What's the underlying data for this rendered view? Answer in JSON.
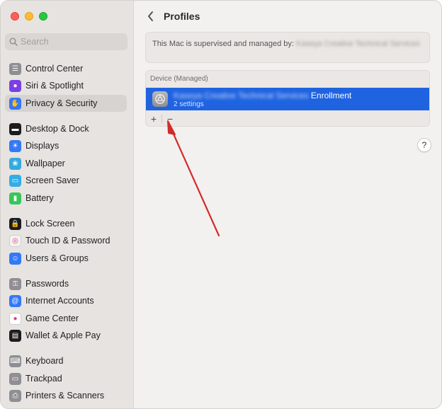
{
  "sidebar": {
    "search_placeholder": "Search",
    "items": [
      {
        "label": "Control Center",
        "icon": "control-center-icon",
        "color": "#8e8e93",
        "selected": false
      },
      {
        "label": "Siri & Spotlight",
        "icon": "siri-icon",
        "color": "#7b3fe4",
        "selected": false
      },
      {
        "label": "Privacy & Security",
        "icon": "hand-icon",
        "color": "#3478f6",
        "selected": true
      },
      {
        "label": "Desktop & Dock",
        "icon": "dock-icon",
        "color": "#1c1c1e",
        "selected": false
      },
      {
        "label": "Displays",
        "icon": "displays-icon",
        "color": "#3478f6",
        "selected": false
      },
      {
        "label": "Wallpaper",
        "icon": "wallpaper-icon",
        "color": "#34aadc",
        "selected": false
      },
      {
        "label": "Screen Saver",
        "icon": "screen-saver-icon",
        "color": "#32ade6",
        "selected": false
      },
      {
        "label": "Battery",
        "icon": "battery-icon",
        "color": "#34c759",
        "selected": false
      },
      {
        "label": "Lock Screen",
        "icon": "lock-icon",
        "color": "#1c1c1e",
        "selected": false
      },
      {
        "label": "Touch ID & Password",
        "icon": "fingerprint-icon",
        "color": "#f2f2f2",
        "selected": false
      },
      {
        "label": "Users & Groups",
        "icon": "users-icon",
        "color": "#3478f6",
        "selected": false
      },
      {
        "label": "Passwords",
        "icon": "key-icon",
        "color": "#8e8e93",
        "selected": false
      },
      {
        "label": "Internet Accounts",
        "icon": "at-icon",
        "color": "#3478f6",
        "selected": false
      },
      {
        "label": "Game Center",
        "icon": "game-center-icon",
        "color": "#ffffff",
        "selected": false
      },
      {
        "label": "Wallet & Apple Pay",
        "icon": "wallet-icon",
        "color": "#1c1c1e",
        "selected": false
      },
      {
        "label": "Keyboard",
        "icon": "keyboard-icon",
        "color": "#8e8e93",
        "selected": false
      },
      {
        "label": "Trackpad",
        "icon": "trackpad-icon",
        "color": "#8e8e93",
        "selected": false
      },
      {
        "label": "Printers & Scanners",
        "icon": "printer-icon",
        "color": "#8e8e93",
        "selected": false
      }
    ]
  },
  "main": {
    "title": "Profiles",
    "supervised_text": "This Mac is supervised and managed by:",
    "supervisor_redacted": "Kaseya Creative Technical Services",
    "list_header": "Device (Managed)",
    "profile_name_redacted": "Kaseya Creative Technical Services",
    "profile_name_suffix": "Enrollment",
    "profile_subtitle": "2 settings",
    "add_label": "+",
    "remove_label": "−",
    "help_label": "?"
  },
  "colors": {
    "accent": "#1f63e0",
    "annotation_arrow": "#d42a2a"
  }
}
